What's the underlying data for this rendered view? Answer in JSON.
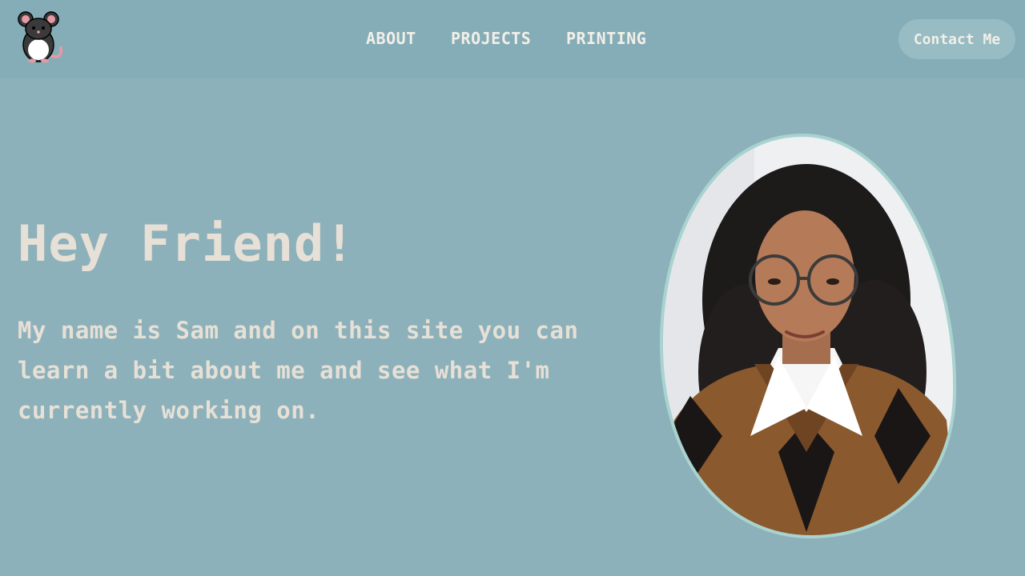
{
  "nav": {
    "about": "ABOUT",
    "projects": "PROJECTS",
    "printing": "PRINTING"
  },
  "contact_label": "Contact Me",
  "hero": {
    "title": "Hey Friend!",
    "intro": "My name is Sam and on this site you can learn a bit about me and see what I'm currently working on."
  },
  "colors": {
    "background": "#8db1ba",
    "header": "#84adb8",
    "text": "#e6e0d6",
    "nav_text": "#f3efe7",
    "portrait_border": "#a9d3cf"
  },
  "icons": {
    "logo": "rat-mascot-icon"
  }
}
